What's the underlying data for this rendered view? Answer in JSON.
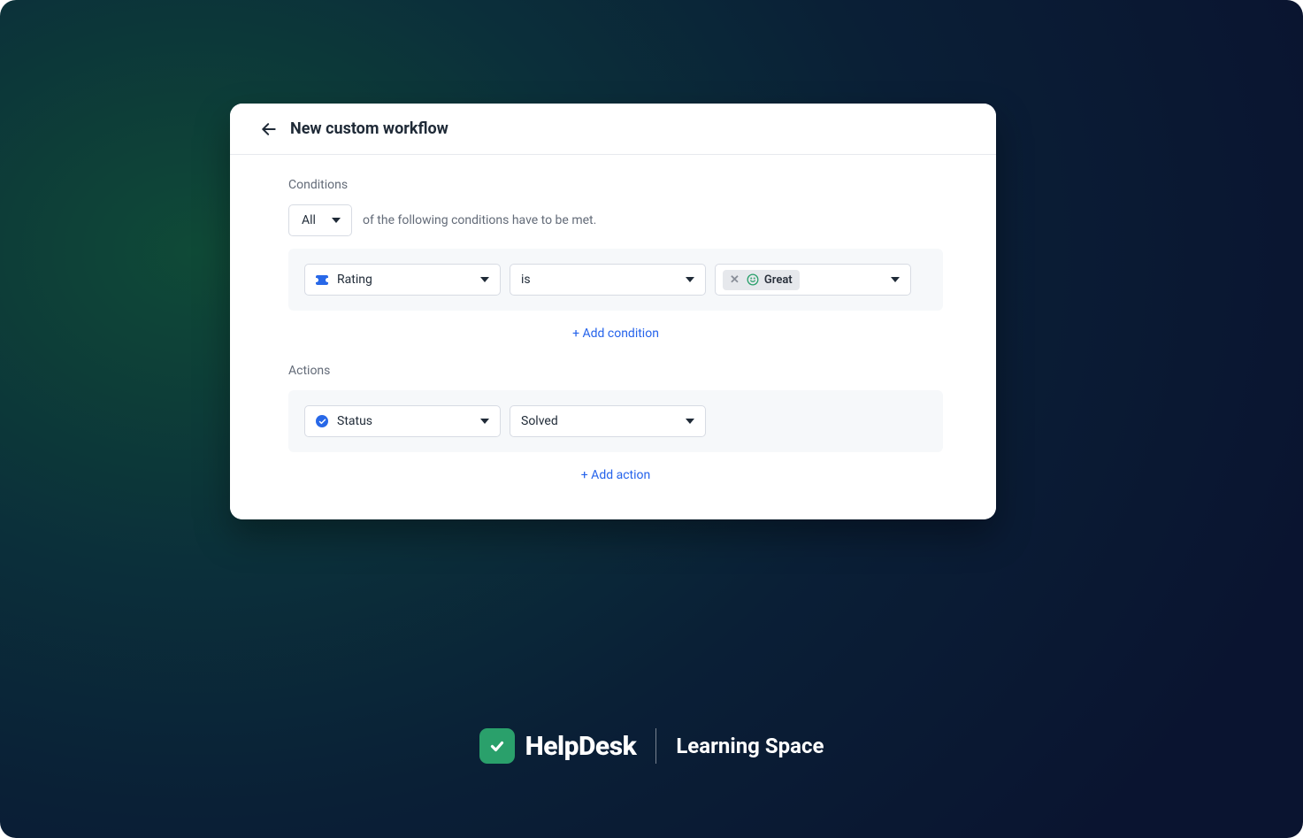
{
  "header": {
    "title": "New custom workflow"
  },
  "conditions": {
    "section_label": "Conditions",
    "match_mode": "All",
    "match_suffix": "of the following conditions have to be met.",
    "row": {
      "field": "Rating",
      "operator": "is",
      "value": "Great"
    },
    "add_label": "+ Add condition"
  },
  "actions": {
    "section_label": "Actions",
    "row": {
      "field": "Status",
      "value": "Solved"
    },
    "add_label": "+ Add action"
  },
  "brand": {
    "product": "HelpDesk",
    "section": "Learning Space"
  }
}
